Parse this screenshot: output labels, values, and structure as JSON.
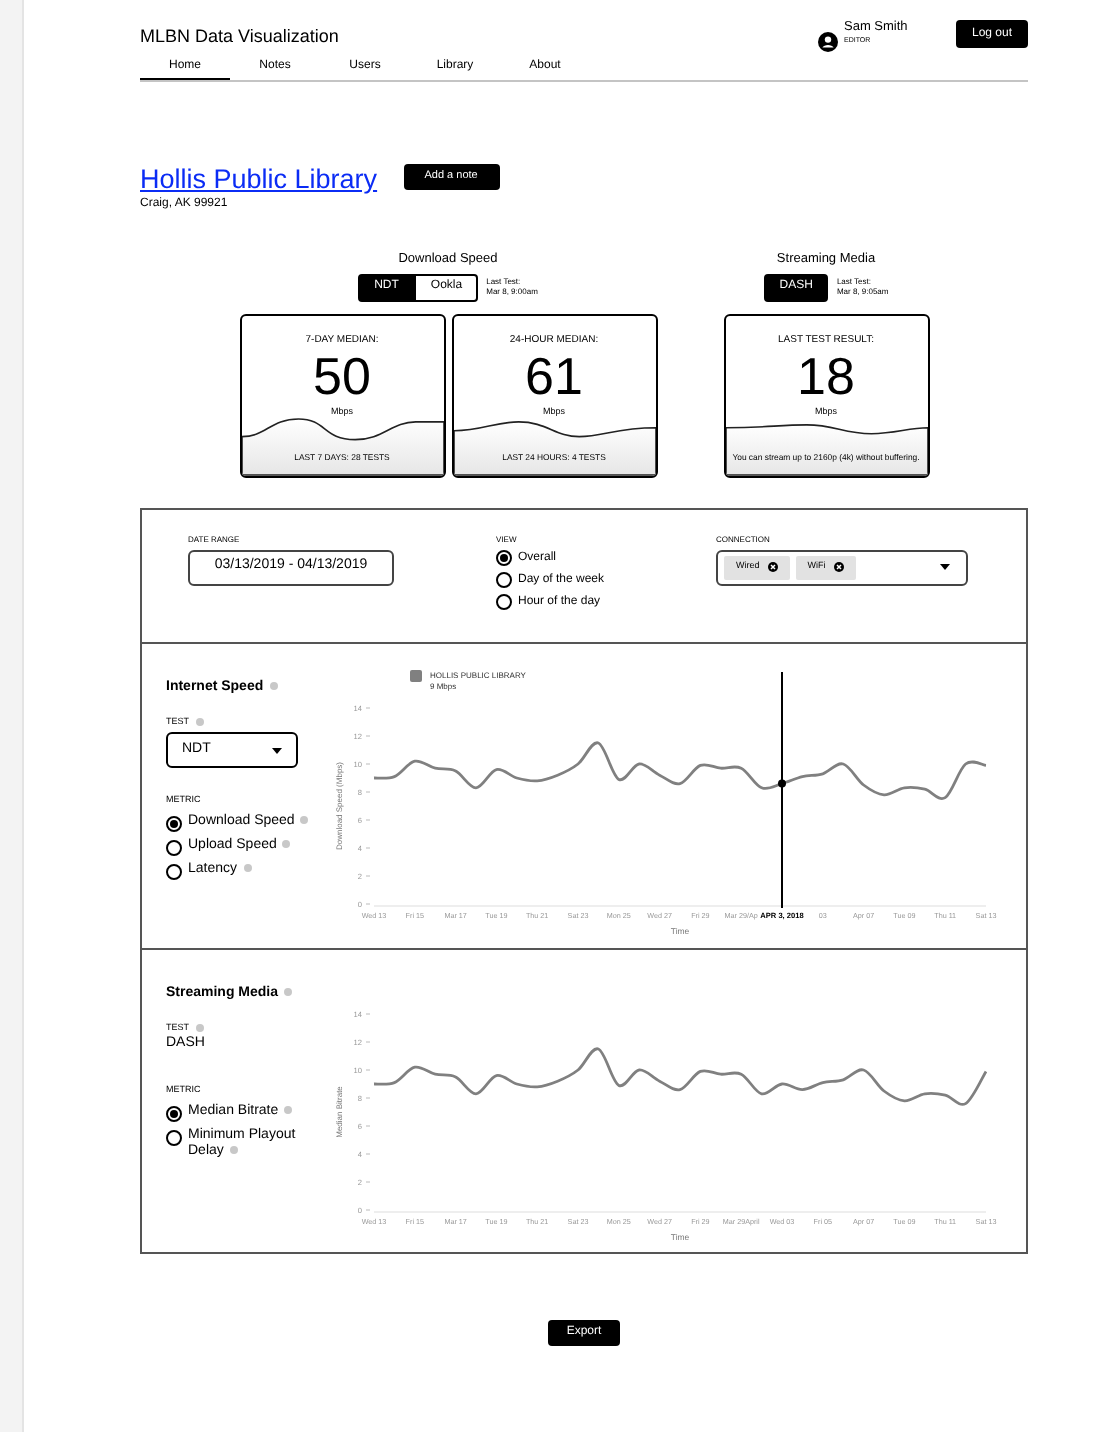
{
  "app": {
    "title": "MLBN Data Visualization"
  },
  "nav": [
    {
      "label": "Home",
      "selected": true
    },
    {
      "label": "Notes",
      "selected": false
    },
    {
      "label": "Users",
      "selected": false
    },
    {
      "label": "Library",
      "selected": false
    },
    {
      "label": "About",
      "selected": false
    }
  ],
  "user": {
    "name": "Sam Smith",
    "role": "EDITOR"
  },
  "logout": "Log out",
  "library": {
    "name": "Hollis Public Library",
    "address": "Craig, AK 99921",
    "add_note": "Add a note"
  },
  "summary": [
    {
      "title": "Download Speed",
      "tests": [
        {
          "label": "NDT",
          "selected": true
        },
        {
          "label": "Ookla",
          "selected": false
        }
      ],
      "last_test_label": "Last Test:",
      "last_test": "Mar 8, 9:00am",
      "cards": [
        {
          "heading": "7-DAY MEDIAN:",
          "value": "50",
          "unit": "Mbps",
          "footer": "LAST 7 DAYS: 28 TESTS"
        },
        {
          "heading": "24-HOUR MEDIAN:",
          "value": "61",
          "unit": "Mbps",
          "footer": "LAST 24 HOURS: 4 TESTS"
        }
      ]
    },
    {
      "title": "Streaming Media",
      "tests": [
        {
          "label": "DASH",
          "selected": true
        }
      ],
      "last_test_label": "Last Test:",
      "last_test": "Mar 8, 9:05am",
      "cards": [
        {
          "heading": "LAST TEST RESULT:",
          "value": "18",
          "unit": "Mbps",
          "footer": "You can stream up to 2160p (4k) without buffering."
        }
      ]
    }
  ],
  "filters": {
    "date_range": {
      "label": "DATE RANGE",
      "value": "03/13/2019 - 04/13/2019"
    },
    "view": {
      "label": "VIEW",
      "options": [
        {
          "label": "Overall",
          "selected": true
        },
        {
          "label": "Day of the week",
          "selected": false
        },
        {
          "label": "Hour of the day",
          "selected": false
        }
      ]
    },
    "connection": {
      "label": "CONNECTION",
      "chips": [
        "Wired",
        "WiFi"
      ]
    }
  },
  "panels": [
    {
      "title": "Internet Speed",
      "test_label": "TEST",
      "test": {
        "kind": "dropdown",
        "value": "NDT"
      },
      "metric_label": "METRIC",
      "metrics": [
        {
          "label": "Download Speed",
          "selected": true
        },
        {
          "label": "Upload Speed",
          "selected": false
        },
        {
          "label": "Latency",
          "selected": false
        }
      ],
      "legend_value": "9 Mbps",
      "chart_data": {
        "type": "line",
        "xlabel": "Time",
        "ylabel": "Download Speed (Mbps)",
        "categories": [
          "Wed 13",
          null,
          "Fri 15",
          null,
          "Mar 17",
          null,
          "Tue 19",
          null,
          "Thu 21",
          null,
          "Sat 23",
          null,
          "Mon 25",
          null,
          "Wed 27",
          null,
          "Fri 29",
          null,
          "Mar 29/Ap",
          null,
          "APR 3, 2018",
          null,
          "03",
          null,
          "Apr 07",
          null,
          "Tue 09",
          null,
          "Thu 11",
          null,
          "Sat 13"
        ],
        "series": [
          {
            "name": "HOLLIS PUBLIC LIBRARY",
            "color": "#808080",
            "values": [
              9,
              9.1,
              10.2,
              9.7,
              9.5,
              8.3,
              9.6,
              9,
              8.8,
              9.2,
              10,
              11.5,
              8.9,
              10,
              9.2,
              8.6,
              9.9,
              9.7,
              9.7,
              8.3,
              8.6,
              9.1,
              9.3,
              10,
              8.5,
              7.8,
              8.3,
              8.2,
              7.6,
              10,
              9.9
            ]
          }
        ],
        "ylim": [
          0,
          14
        ],
        "yticks": [
          0,
          2,
          4,
          6,
          8,
          10,
          12,
          14
        ],
        "annotations": [
          {
            "x": "APR 3, 2018"
          }
        ]
      }
    },
    {
      "title": "Streaming Media",
      "test_label": "TEST",
      "test": {
        "kind": "text",
        "value": "DASH"
      },
      "metric_label": "METRIC",
      "metrics": [
        {
          "label": "Median Bitrate",
          "selected": true
        },
        {
          "label": "Minimum Playout Delay",
          "selected": false
        }
      ],
      "chart_data": {
        "type": "line",
        "xlabel": "Time",
        "ylabel": "Median Bitrate",
        "categories": [
          "Wed 13",
          null,
          "Fri 15",
          null,
          "Mar 17",
          null,
          "Tue 19",
          null,
          "Thu 21",
          null,
          "Sat 23",
          null,
          "Mon 25",
          null,
          "Wed 27",
          null,
          "Fri 29",
          null,
          "Mar 29April",
          null,
          "Wed 03",
          null,
          "Fri 05",
          null,
          "Apr 07",
          null,
          "Tue 09",
          null,
          "Thu 11",
          null,
          "Sat 13"
        ],
        "series": [
          {
            "color": "#808080",
            "values": [
              9,
              9.1,
              10.2,
              9.7,
              9.5,
              8.3,
              9.6,
              9,
              8.8,
              9.2,
              10,
              11.5,
              8.9,
              10,
              9.2,
              8.6,
              9.9,
              9.7,
              9.7,
              8.3,
              9,
              8.6,
              9.1,
              9.3,
              10,
              8.5,
              7.8,
              8.3,
              8.2,
              7.6,
              9.9
            ]
          }
        ],
        "ylim": [
          0,
          14
        ],
        "yticks": [
          0,
          2,
          4,
          6,
          8,
          10,
          12,
          14
        ]
      }
    }
  ],
  "export": "Export"
}
